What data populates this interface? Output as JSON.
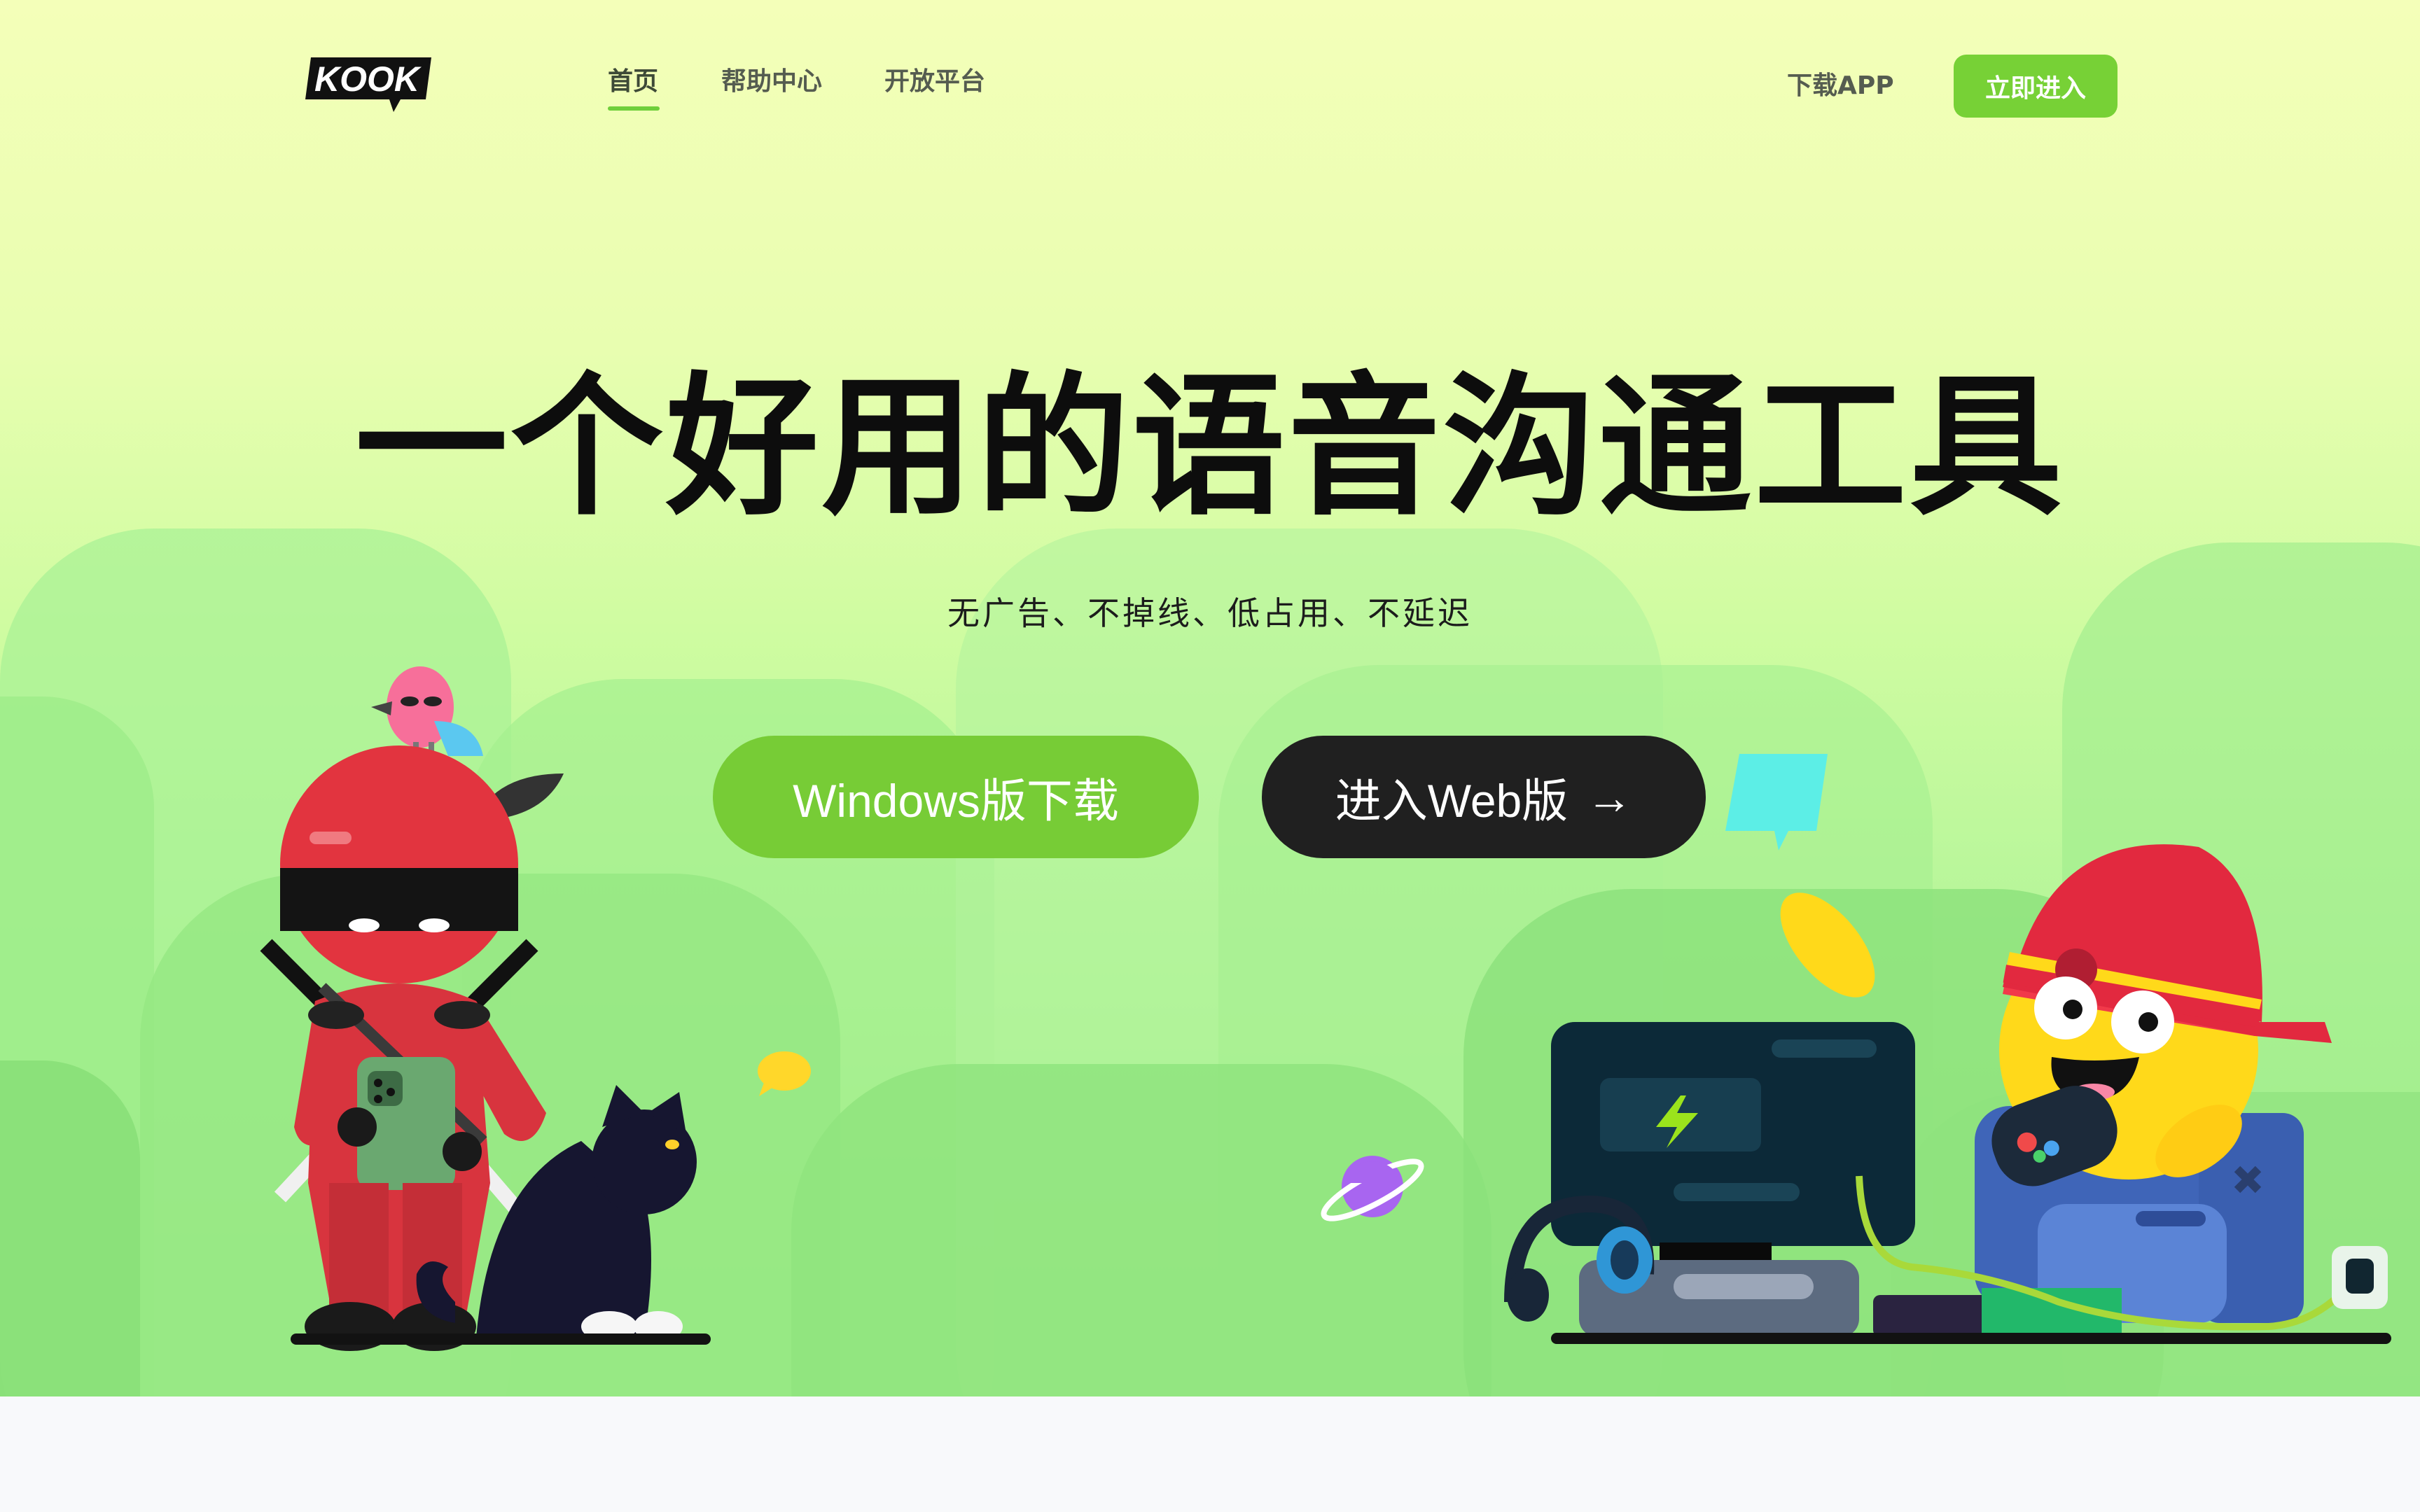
{
  "brand": {
    "logo_text": "KOOK"
  },
  "nav": {
    "items": [
      {
        "label": "首页",
        "active": true
      },
      {
        "label": "帮助中心",
        "active": false
      },
      {
        "label": "开放平台",
        "active": false
      }
    ],
    "download_label": "下载APP",
    "enter_label": "立即进入"
  },
  "hero": {
    "title": "一个好用的语音沟通工具",
    "subtitle": "无广告、不掉线、低占用、不延迟",
    "cta_windows": "Windows版下载",
    "cta_web": "进入Web版",
    "cta_web_arrow": "→"
  },
  "colors": {
    "accent": "#77cc36",
    "dark_button": "#202020",
    "hero_gradient_top": "#f4ffb9",
    "hero_gradient_bottom": "#97e985"
  },
  "icons": {
    "web_arrow": "arrow-right-icon"
  }
}
